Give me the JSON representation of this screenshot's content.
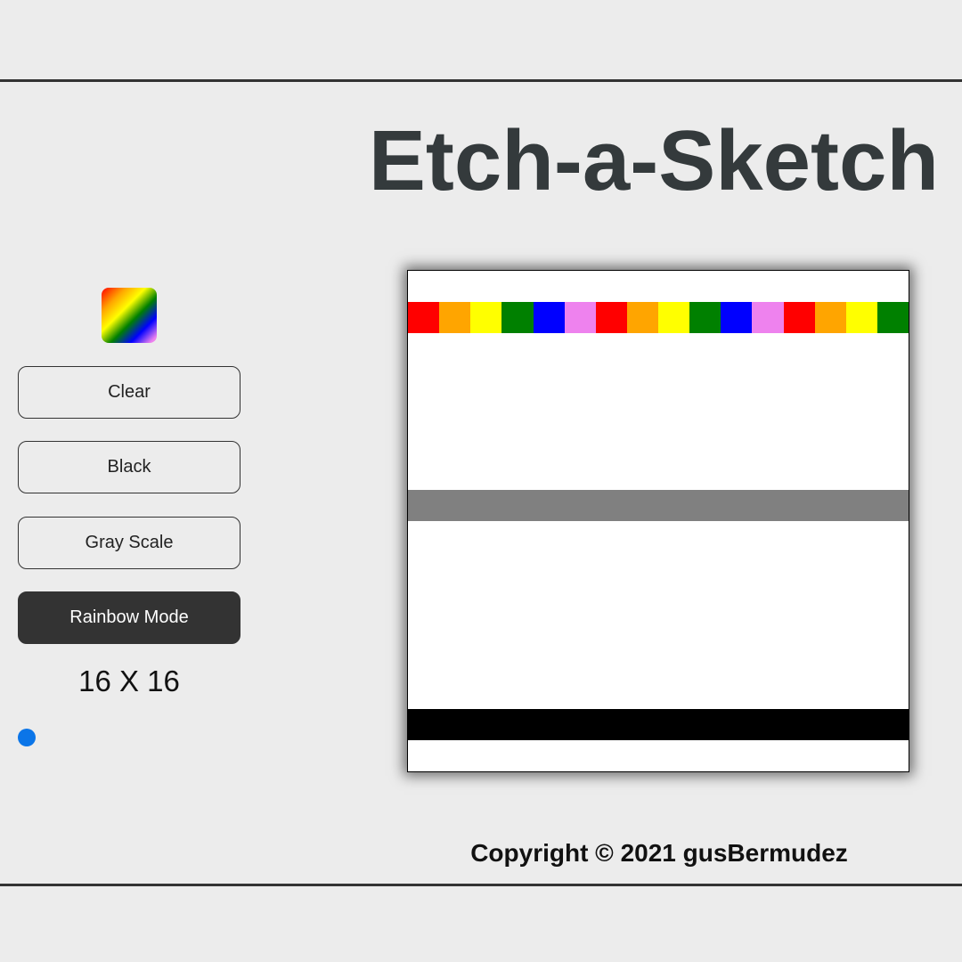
{
  "header": {
    "title": "Etch-a-Sketch"
  },
  "controls": {
    "color_picker_icon": "rainbow-swatch-icon",
    "buttons": {
      "clear": "Clear",
      "black": "Black",
      "gray": "Gray Scale",
      "rainbow": "Rainbow Mode"
    },
    "active_mode": "rainbow",
    "grid_size_label": "16 X 16",
    "grid_size": 16,
    "slider_value": 16
  },
  "colors": {
    "background": "#ececec",
    "active_button": "#333333",
    "slider_thumb": "#0b75e8",
    "gray": "#808080",
    "black": "#000000",
    "rainbow": [
      "#ff0000",
      "#ffa500",
      "#ffff00",
      "#008000",
      "#0000ff",
      "#ee82ee"
    ]
  },
  "canvas": {
    "size": 16,
    "painted_rows": [
      {
        "row": 1,
        "fill": "rainbow"
      },
      {
        "row": 7,
        "fill": "gray"
      },
      {
        "row": 14,
        "fill": "black"
      }
    ]
  },
  "footer": {
    "copyright": "Copyright © 2021 gusBermudez"
  }
}
